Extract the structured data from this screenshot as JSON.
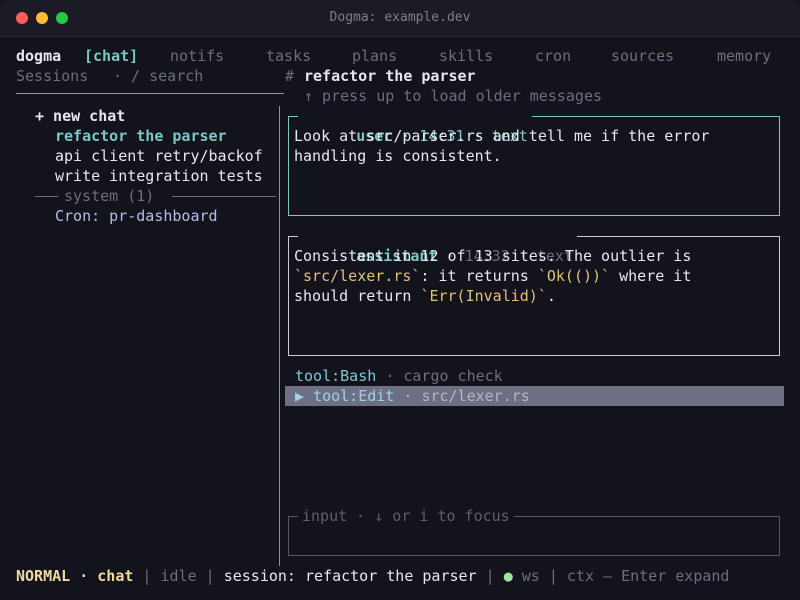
{
  "window": {
    "title": "Dogma: example.dev"
  },
  "colors": {
    "accent_teal": "#7ec7c7",
    "code": "#e5c07b",
    "status_ok": "#a6e3a1",
    "mode": "#f0d9a0"
  },
  "nav": {
    "app": "dogma",
    "tabs": [
      {
        "label": "[chat]"
      },
      {
        "label": "notifs"
      },
      {
        "label": "tasks"
      },
      {
        "label": "plans"
      },
      {
        "label": "skills"
      },
      {
        "label": "cron"
      },
      {
        "label": "sources"
      },
      {
        "label": "memory"
      }
    ]
  },
  "sidebar": {
    "header": "Sessions",
    "search_hint": "· / search",
    "new_chat": "+ new chat",
    "sessions": [
      {
        "label": "refactor the parser"
      },
      {
        "label": "api client retry/backof"
      },
      {
        "label": "write integration tests"
      }
    ],
    "system_header": "system (1)",
    "system_sessions": [
      {
        "label": "Cron: pr-dashboard"
      }
    ]
  },
  "chat": {
    "title_prefix": "#",
    "title": "refactor the parser",
    "older_hint": "↑ press up to load older messages",
    "user_msg": {
      "role": "user",
      "time": "14:31",
      "kind": "text",
      "lines": [
        "Look at src/parser.rs and tell me if the error",
        "handling is consistent."
      ]
    },
    "assistant_msg": {
      "role": "assistant",
      "time": "14:32",
      "kind": "text",
      "line1": "Consistent in 12 of 13 sites. The outlier is",
      "line2_code1": "`src/lexer.rs`",
      "line2_mid": ": it returns ",
      "line2_code2": "`Ok(())`",
      "line2_end": " where it",
      "line3_pre": "should return ",
      "line3_code": "`Err(Invalid)`",
      "line3_end": "."
    },
    "tools": [
      {
        "name": "tool:Bash",
        "sep": "·",
        "detail": "cargo check"
      },
      {
        "marker": "▶",
        "name": "tool:Edit",
        "sep": "·",
        "detail": "src/lexer.rs"
      }
    ],
    "input": {
      "placeholder": "input · ↓ or i to focus"
    }
  },
  "statusbar": {
    "mode": "NORMAL · chat",
    "state": "idle",
    "session": "session: refactor the parser",
    "ws_dot": "●",
    "ws": "ws",
    "hint": "ctx — Enter expand"
  }
}
